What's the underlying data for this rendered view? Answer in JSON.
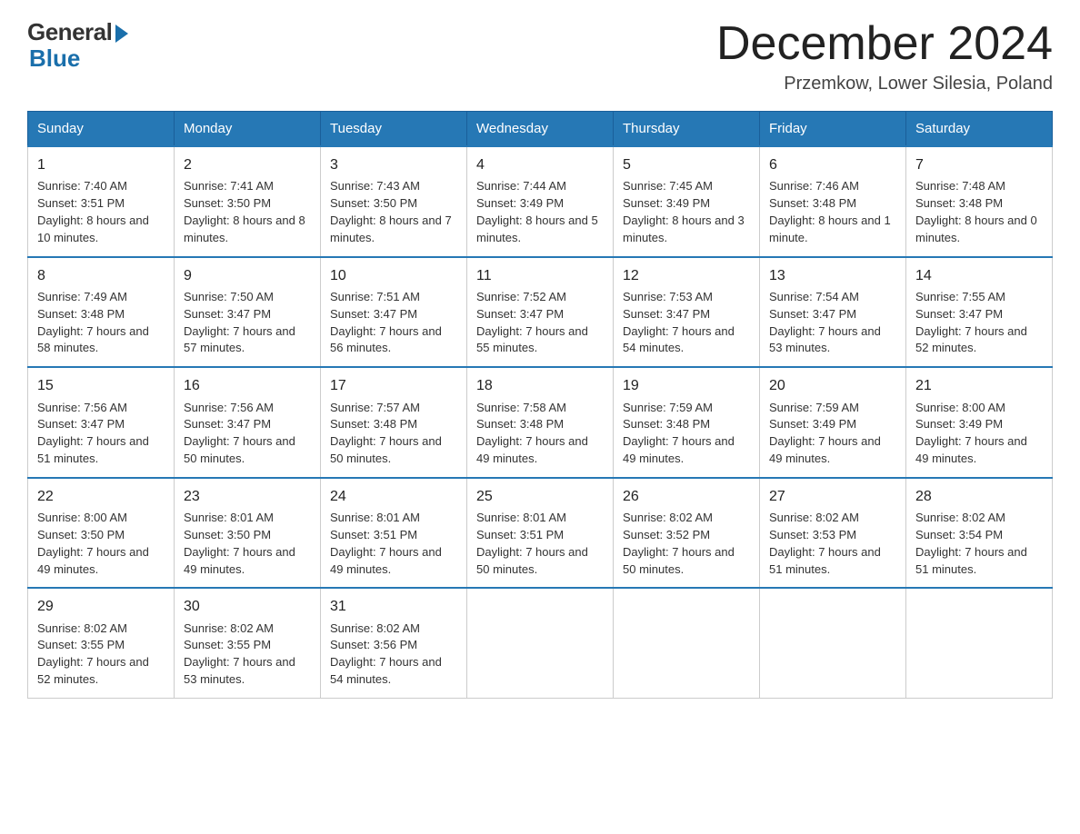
{
  "header": {
    "logo_general": "General",
    "logo_blue": "Blue",
    "month_title": "December 2024",
    "subtitle": "Przemkow, Lower Silesia, Poland"
  },
  "weekdays": [
    "Sunday",
    "Monday",
    "Tuesday",
    "Wednesday",
    "Thursday",
    "Friday",
    "Saturday"
  ],
  "weeks": [
    [
      {
        "day": 1,
        "sunrise": "7:40 AM",
        "sunset": "3:51 PM",
        "daylight": "8 hours and 10 minutes."
      },
      {
        "day": 2,
        "sunrise": "7:41 AM",
        "sunset": "3:50 PM",
        "daylight": "8 hours and 8 minutes."
      },
      {
        "day": 3,
        "sunrise": "7:43 AM",
        "sunset": "3:50 PM",
        "daylight": "8 hours and 7 minutes."
      },
      {
        "day": 4,
        "sunrise": "7:44 AM",
        "sunset": "3:49 PM",
        "daylight": "8 hours and 5 minutes."
      },
      {
        "day": 5,
        "sunrise": "7:45 AM",
        "sunset": "3:49 PM",
        "daylight": "8 hours and 3 minutes."
      },
      {
        "day": 6,
        "sunrise": "7:46 AM",
        "sunset": "3:48 PM",
        "daylight": "8 hours and 1 minute."
      },
      {
        "day": 7,
        "sunrise": "7:48 AM",
        "sunset": "3:48 PM",
        "daylight": "8 hours and 0 minutes."
      }
    ],
    [
      {
        "day": 8,
        "sunrise": "7:49 AM",
        "sunset": "3:48 PM",
        "daylight": "7 hours and 58 minutes."
      },
      {
        "day": 9,
        "sunrise": "7:50 AM",
        "sunset": "3:47 PM",
        "daylight": "7 hours and 57 minutes."
      },
      {
        "day": 10,
        "sunrise": "7:51 AM",
        "sunset": "3:47 PM",
        "daylight": "7 hours and 56 minutes."
      },
      {
        "day": 11,
        "sunrise": "7:52 AM",
        "sunset": "3:47 PM",
        "daylight": "7 hours and 55 minutes."
      },
      {
        "day": 12,
        "sunrise": "7:53 AM",
        "sunset": "3:47 PM",
        "daylight": "7 hours and 54 minutes."
      },
      {
        "day": 13,
        "sunrise": "7:54 AM",
        "sunset": "3:47 PM",
        "daylight": "7 hours and 53 minutes."
      },
      {
        "day": 14,
        "sunrise": "7:55 AM",
        "sunset": "3:47 PM",
        "daylight": "7 hours and 52 minutes."
      }
    ],
    [
      {
        "day": 15,
        "sunrise": "7:56 AM",
        "sunset": "3:47 PM",
        "daylight": "7 hours and 51 minutes."
      },
      {
        "day": 16,
        "sunrise": "7:56 AM",
        "sunset": "3:47 PM",
        "daylight": "7 hours and 50 minutes."
      },
      {
        "day": 17,
        "sunrise": "7:57 AM",
        "sunset": "3:48 PM",
        "daylight": "7 hours and 50 minutes."
      },
      {
        "day": 18,
        "sunrise": "7:58 AM",
        "sunset": "3:48 PM",
        "daylight": "7 hours and 49 minutes."
      },
      {
        "day": 19,
        "sunrise": "7:59 AM",
        "sunset": "3:48 PM",
        "daylight": "7 hours and 49 minutes."
      },
      {
        "day": 20,
        "sunrise": "7:59 AM",
        "sunset": "3:49 PM",
        "daylight": "7 hours and 49 minutes."
      },
      {
        "day": 21,
        "sunrise": "8:00 AM",
        "sunset": "3:49 PM",
        "daylight": "7 hours and 49 minutes."
      }
    ],
    [
      {
        "day": 22,
        "sunrise": "8:00 AM",
        "sunset": "3:50 PM",
        "daylight": "7 hours and 49 minutes."
      },
      {
        "day": 23,
        "sunrise": "8:01 AM",
        "sunset": "3:50 PM",
        "daylight": "7 hours and 49 minutes."
      },
      {
        "day": 24,
        "sunrise": "8:01 AM",
        "sunset": "3:51 PM",
        "daylight": "7 hours and 49 minutes."
      },
      {
        "day": 25,
        "sunrise": "8:01 AM",
        "sunset": "3:51 PM",
        "daylight": "7 hours and 50 minutes."
      },
      {
        "day": 26,
        "sunrise": "8:02 AM",
        "sunset": "3:52 PM",
        "daylight": "7 hours and 50 minutes."
      },
      {
        "day": 27,
        "sunrise": "8:02 AM",
        "sunset": "3:53 PM",
        "daylight": "7 hours and 51 minutes."
      },
      {
        "day": 28,
        "sunrise": "8:02 AM",
        "sunset": "3:54 PM",
        "daylight": "7 hours and 51 minutes."
      }
    ],
    [
      {
        "day": 29,
        "sunrise": "8:02 AM",
        "sunset": "3:55 PM",
        "daylight": "7 hours and 52 minutes."
      },
      {
        "day": 30,
        "sunrise": "8:02 AM",
        "sunset": "3:55 PM",
        "daylight": "7 hours and 53 minutes."
      },
      {
        "day": 31,
        "sunrise": "8:02 AM",
        "sunset": "3:56 PM",
        "daylight": "7 hours and 54 minutes."
      },
      null,
      null,
      null,
      null
    ]
  ]
}
